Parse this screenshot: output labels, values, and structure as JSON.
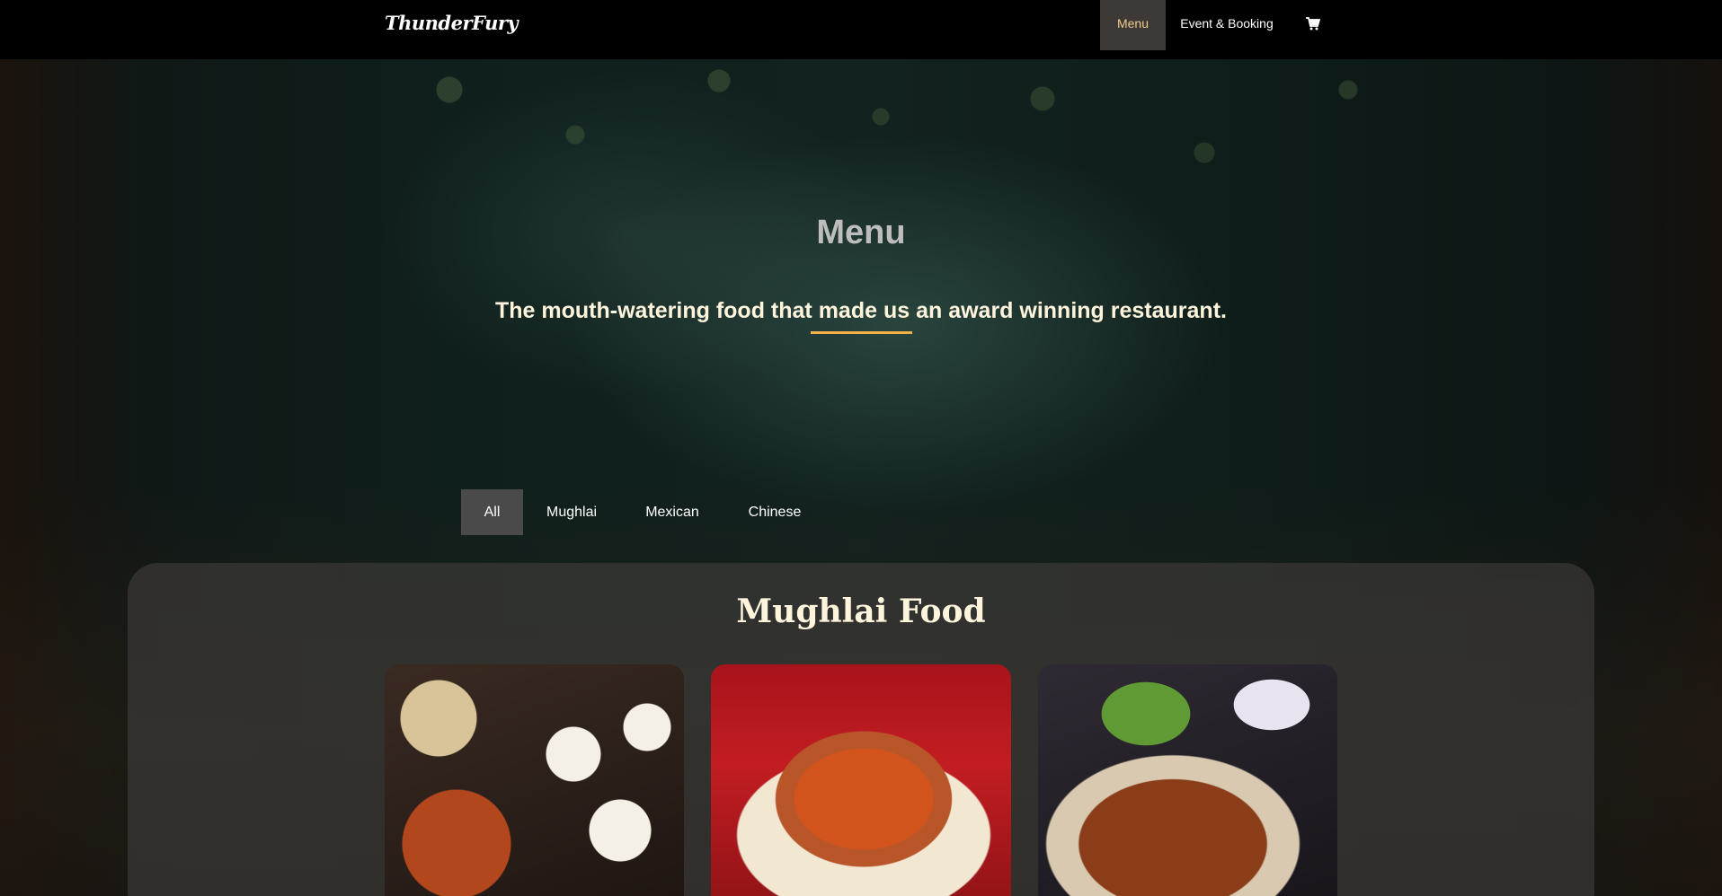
{
  "navbar": {
    "brand": "ThunderFury",
    "items": [
      {
        "label": "Menu",
        "active": true
      },
      {
        "label": "Event & Booking",
        "active": false
      }
    ],
    "cart_icon": "shopping-cart-icon",
    "active_bg": "#3c3937",
    "active_color": "#f1c98a"
  },
  "hero": {
    "title": "Menu",
    "subtitle": "The mouth-watering food that made us an award winning restaurant.",
    "accent": "#f0b04a"
  },
  "filters": {
    "tabs": [
      "All",
      "Mughlai",
      "Mexican",
      "Chinese"
    ],
    "selected": "All"
  },
  "section": {
    "title": "Mughlai Food",
    "cards": [
      {
        "image": "mughlai-platter-photo"
      },
      {
        "image": "curry-bowl-with-naan-photo"
      },
      {
        "image": "grilled-chicken-platter-photo"
      }
    ]
  }
}
